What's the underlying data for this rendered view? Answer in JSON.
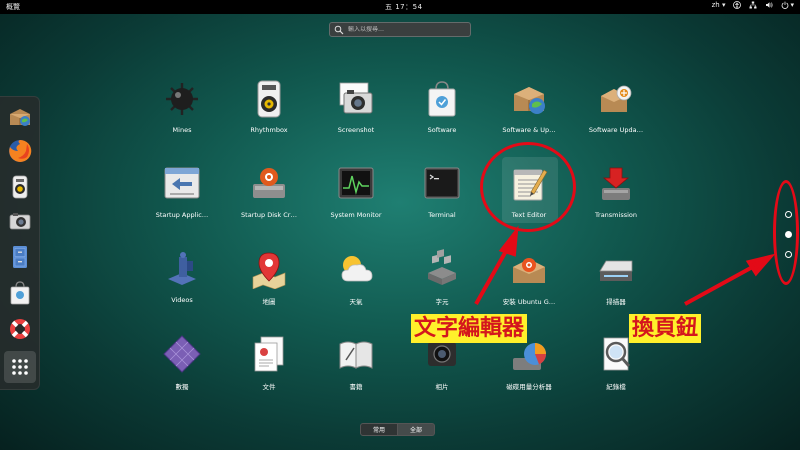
{
  "topbar": {
    "activities": "概覽",
    "clock": "五 17：54",
    "lang": "zh",
    "lang_arrow": "▾",
    "power_arrow": "▾"
  },
  "search": {
    "placeholder": "輸入以搜尋…"
  },
  "apps": [
    {
      "label": "Mines",
      "icon": "mines-icon"
    },
    {
      "label": "Rhythmbox",
      "icon": "rhythmbox-icon"
    },
    {
      "label": "Screenshot",
      "icon": "screenshot-icon"
    },
    {
      "label": "Software",
      "icon": "software-icon"
    },
    {
      "label": "Software & Up…",
      "icon": "software-sources-icon"
    },
    {
      "label": "Software Upda…",
      "icon": "software-updater-icon"
    },
    {
      "label": "Startup Applic…",
      "icon": "startup-applications-icon"
    },
    {
      "label": "Startup Disk Cr…",
      "icon": "startup-disk-creator-icon"
    },
    {
      "label": "System Monitor",
      "icon": "system-monitor-icon"
    },
    {
      "label": "Terminal",
      "icon": "terminal-icon"
    },
    {
      "label": "Text Editor",
      "icon": "text-editor-icon"
    },
    {
      "label": "Transmission",
      "icon": "transmission-icon"
    },
    {
      "label": "Videos",
      "icon": "videos-icon"
    },
    {
      "label": "地圖",
      "icon": "maps-icon"
    },
    {
      "label": "天氣",
      "icon": "weather-icon"
    },
    {
      "label": "字元",
      "icon": "characters-icon"
    },
    {
      "label": "安裝 Ubuntu G…",
      "icon": "install-ubuntu-icon"
    },
    {
      "label": "掃描器",
      "icon": "scanner-icon"
    },
    {
      "label": "數獨",
      "icon": "sudoku-icon"
    },
    {
      "label": "文件",
      "icon": "documents-icon"
    },
    {
      "label": "書籍",
      "icon": "books-icon"
    },
    {
      "label": "相片",
      "icon": "photos-icon"
    },
    {
      "label": "磁碟用量分析器",
      "icon": "disk-usage-icon"
    },
    {
      "label": "紀錄檔",
      "icon": "logs-icon"
    }
  ],
  "annotations": {
    "text_editor": "文字編輯器",
    "page_buttons": "換頁鈕"
  },
  "tabs": [
    {
      "label": "常用",
      "active": false
    },
    {
      "label": "全部",
      "active": true
    }
  ],
  "colors": {
    "annotation_red": "#e30a17",
    "annotation_bg": "#fff02b"
  }
}
